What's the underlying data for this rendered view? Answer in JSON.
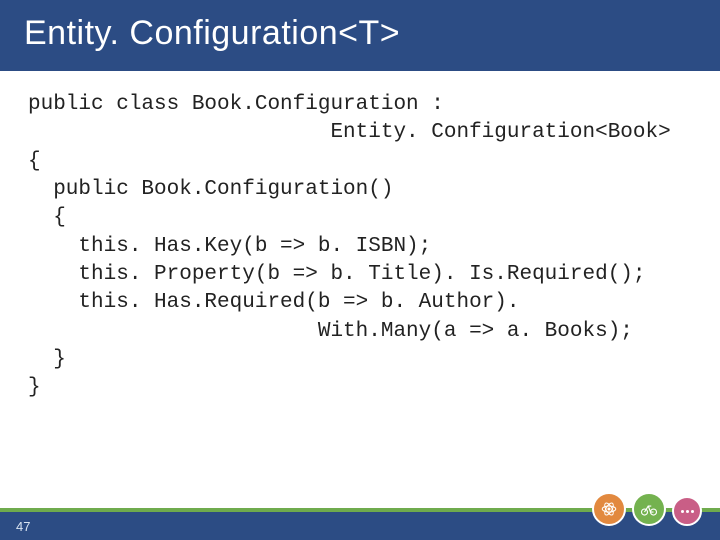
{
  "title": "Entity. Configuration<T>",
  "code": "public class Book.Configuration :\n                        Entity. Configuration<Book>\n{\n  public Book.Configuration()\n  {\n    this. Has.Key(b => b. ISBN);\n    this. Property(b => b. Title). Is.Required();\n    this. Has.Required(b => b. Author).\n                       With.Many(a => a. Books);\n  }\n}",
  "slide_number": "47",
  "icons": {
    "badge1": "atom-icon",
    "badge2": "bike-icon",
    "badge3": "chat-icon"
  }
}
